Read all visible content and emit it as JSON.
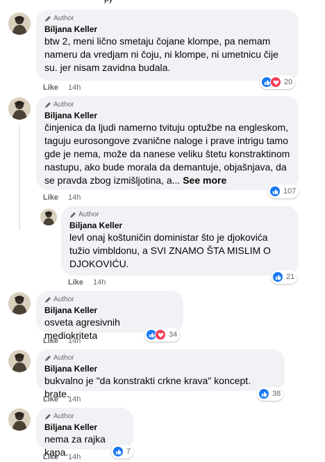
{
  "header_fragment": "py",
  "author_badge": "Author",
  "comments": [
    {
      "name": "Biljana Keller",
      "text": "btw 2, meni lično smetaju čojane klompe, pa nemam nameru da vredjam ni čoju, ni klompe, ni umetnicu čije su. jer nisam zavidna budala.",
      "like": "Like",
      "time": "14h",
      "reaction_count": "20",
      "reactions": [
        "like-icon",
        "love-icon"
      ]
    },
    {
      "name": "Biljana Keller",
      "text": "činjenica da ljudi namerno tvituju optužbe na engleskom, taguju eurosongove zvanične naloge i prave intrigu tamo gde je nema, može da nanese veliku štetu konstraktinom nastupu, ako bude morala da demantuje, objašnjava, da se pravda zbog izmišljotina, a...",
      "see_more": "See more",
      "like": "Like",
      "time": "14h",
      "reaction_count": "107",
      "reactions": [
        "like-icon"
      ]
    },
    {
      "name": "Biljana Keller",
      "text": "levl onaj koštuničin doministar što je djokovića tužio vimbldonu, a SVI ZNAMO ŠTA MISLIM O DJOKOVIĆU.",
      "like": "Like",
      "time": "14h",
      "reaction_count": "21",
      "reactions": [
        "like-icon"
      ]
    },
    {
      "name": "Biljana Keller",
      "text": "osveta agresivnih mediokriteta",
      "like": "Like",
      "time": "14h",
      "reaction_count": "34",
      "reactions": [
        "like-icon",
        "love-icon"
      ]
    },
    {
      "name": "Biljana Keller",
      "text": "bukvalno je \"da konstrakti crkne krava\" koncept. brate.",
      "like": "Like",
      "time": "14h",
      "reaction_count": "38",
      "reactions": [
        "like-icon"
      ]
    },
    {
      "name": "Biljana Keller",
      "text": "nema za rajka kapa.",
      "like": "Like",
      "time": "14h",
      "reaction_count": "7",
      "reactions": [
        "like-icon"
      ]
    }
  ],
  "colors": {
    "bubble": "#f0f2f5",
    "like_blue": "#1877f2",
    "love_red": "#f33e58",
    "meta_gray": "#65676b"
  }
}
